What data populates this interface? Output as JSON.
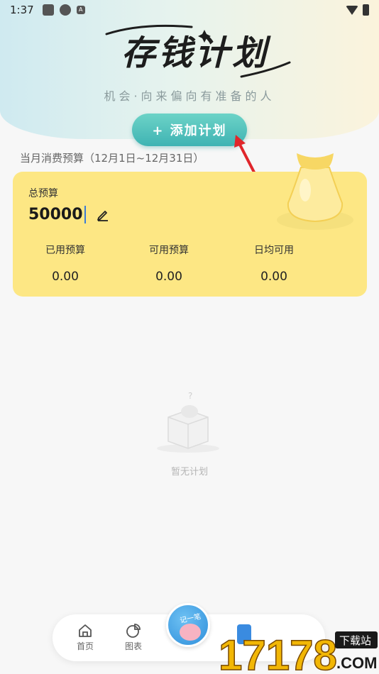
{
  "status_bar": {
    "time": "1:37",
    "a_icon": "A"
  },
  "hero": {
    "title": "存钱计划",
    "subtitle": "机会·向来偏向有准备的人",
    "add_button": "+ 添加计划"
  },
  "budget": {
    "period": "当月消费预算（12月1日~12月31日）",
    "total_label": "总预算",
    "total_value": "50000",
    "stats": [
      {
        "label": "已用预算",
        "value": "0.00"
      },
      {
        "label": "可用预算",
        "value": "0.00"
      },
      {
        "label": "日均可用",
        "value": "0.00"
      }
    ]
  },
  "empty_state": {
    "text": "暂无计划"
  },
  "nav": {
    "items": [
      {
        "label": "首页",
        "icon": "home-icon"
      },
      {
        "label": "图表",
        "icon": "pie-chart-icon"
      }
    ],
    "center_label": "记一笔"
  },
  "watermark": {
    "number": "17178",
    "brand": "下载站",
    "domain": ".COM"
  },
  "colors": {
    "accent": "#3fb3b3",
    "card": "#fde784",
    "arrow": "#e0262b"
  }
}
